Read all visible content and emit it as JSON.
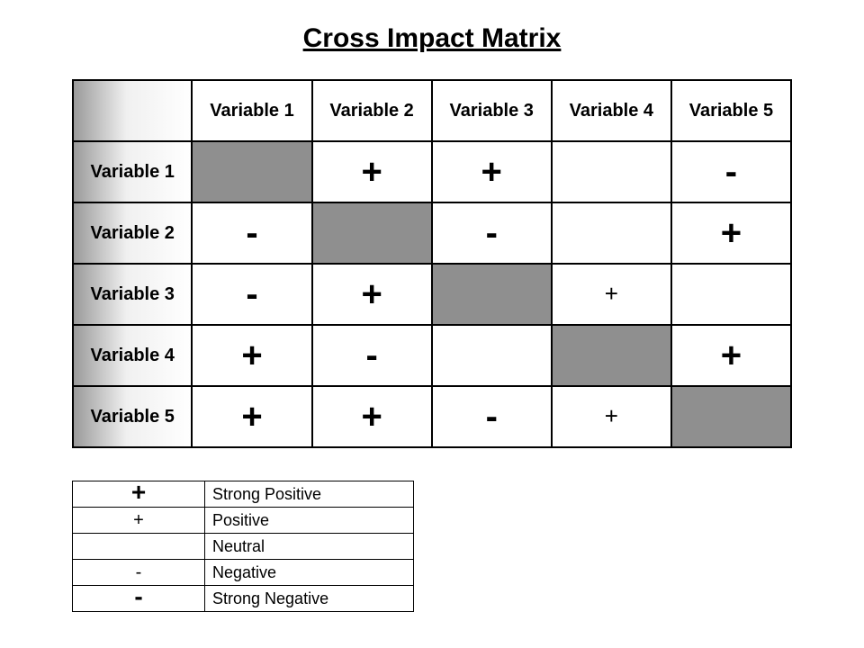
{
  "title": "Cross Impact Matrix",
  "headers": [
    "Variable 1",
    "Variable 2",
    "Variable 3",
    "Variable 4",
    "Variable 5"
  ],
  "rowheaders": [
    "Variable 1",
    "Variable 2",
    "Variable 3",
    "Variable 4",
    "Variable 5"
  ],
  "cells": [
    [
      {
        "diag": true
      },
      {
        "sym": "+",
        "w": "strong"
      },
      {
        "sym": "+",
        "w": "strong"
      },
      {
        "sym": "",
        "w": "blank"
      },
      {
        "sym": "-",
        "w": "strong"
      }
    ],
    [
      {
        "sym": "-",
        "w": "strong"
      },
      {
        "diag": true
      },
      {
        "sym": "-",
        "w": "strong"
      },
      {
        "sym": "",
        "w": "blank"
      },
      {
        "sym": "+",
        "w": "strong"
      }
    ],
    [
      {
        "sym": "-",
        "w": "strong"
      },
      {
        "sym": "+",
        "w": "strong"
      },
      {
        "diag": true
      },
      {
        "sym": "+",
        "w": "norm"
      },
      {
        "sym": "",
        "w": "blank"
      }
    ],
    [
      {
        "sym": "+",
        "w": "strong"
      },
      {
        "sym": "-",
        "w": "strong"
      },
      {
        "sym": "",
        "w": "blank"
      },
      {
        "diag": true
      },
      {
        "sym": "+",
        "w": "strong"
      }
    ],
    [
      {
        "sym": "+",
        "w": "strong"
      },
      {
        "sym": "+",
        "w": "strong"
      },
      {
        "sym": "-",
        "w": "strong"
      },
      {
        "sym": "+",
        "w": "norm"
      },
      {
        "diag": true
      }
    ]
  ],
  "legend": [
    {
      "sym": "+",
      "w": "strong",
      "label": "Strong Positive"
    },
    {
      "sym": "+",
      "w": "norm",
      "label": "Positive"
    },
    {
      "sym": "",
      "w": "blank",
      "label": "Neutral"
    },
    {
      "sym": "-",
      "w": "norm",
      "label": "Negative"
    },
    {
      "sym": "-",
      "w": "strong",
      "label": "Strong Negative"
    }
  ],
  "chart_data": {
    "type": "table",
    "title": "Cross Impact Matrix",
    "row_labels": [
      "Variable 1",
      "Variable 2",
      "Variable 3",
      "Variable 4",
      "Variable 5"
    ],
    "col_labels": [
      "Variable 1",
      "Variable 2",
      "Variable 3",
      "Variable 4",
      "Variable 5"
    ],
    "scale": {
      "strong_positive": 2,
      "positive": 1,
      "neutral": 0,
      "negative": -1,
      "strong_negative": -2,
      "diagonal": null
    },
    "values": [
      [
        null,
        2,
        2,
        0,
        -2
      ],
      [
        -2,
        null,
        -2,
        0,
        2
      ],
      [
        -2,
        2,
        null,
        1,
        0
      ],
      [
        2,
        -2,
        0,
        null,
        2
      ],
      [
        2,
        2,
        -2,
        1,
        null
      ]
    ],
    "legend": [
      {
        "symbol": "+ (bold)",
        "meaning": "Strong Positive",
        "value": 2
      },
      {
        "symbol": "+",
        "meaning": "Positive",
        "value": 1
      },
      {
        "symbol": "(blank)",
        "meaning": "Neutral",
        "value": 0
      },
      {
        "symbol": "-",
        "meaning": "Negative",
        "value": -1
      },
      {
        "symbol": "- (bold)",
        "meaning": "Strong Negative",
        "value": -2
      }
    ]
  }
}
